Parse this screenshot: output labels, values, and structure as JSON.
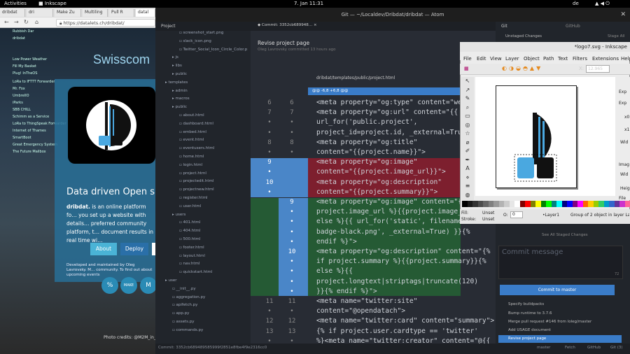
{
  "desktop": {
    "activities": "Activities",
    "app_name": "Inkscape",
    "clock": "7. Jan  11:31",
    "locale": "de"
  },
  "browser": {
    "tabs": [
      "dribdat",
      "dri",
      "Make Zu",
      "Multiling",
      "Pull R",
      "datal"
    ],
    "url": "https://datalets.ch/dribdat/",
    "swisscom": "Swisscom",
    "tagline": "Data driven Open s",
    "description_bold": "dribdat.",
    "description": " is an online platform fo… you set up a website with details… preferred community platform, t… document results in real time wi…",
    "buttons": [
      "About",
      "Deploy"
    ],
    "credit": "Developed and maintained by Oleg Lavrovsky. M… community. To find out about upcoming events",
    "round_buttons": [
      "%",
      "MAKE",
      "M"
    ],
    "photo_credit": "Photo credits: @M2M_in_Ac",
    "side_list": [
      "Rubbish Dar",
      "dribdat",
      "Low Power Weather",
      "Fill My Basket",
      "Plug! InTheOS",
      "LoRa to IFTTT Forwarder",
      "Mr. Fox",
      "UmbrelIO",
      "iParks",
      "SBB CHILL",
      "Schimm as a Service",
      "LoRa to ThingSpeak Forwarder",
      "Internet of Thames",
      "SmartBoot",
      "Great Emergency System",
      "The Future Mailbox"
    ]
  },
  "atom": {
    "window_title": "Git — ~/Localdev/Dribdat/dribdat — Atom",
    "project_tab": "Project",
    "editor_tab": "Commit: 3352cb689948…",
    "commit_title": "Revise project page",
    "commit_meta": "Oleg Lavrovsky committed 13 hours ago",
    "file_path": "dribdat/templates/public/project.html",
    "hunk_header": "@@ -6,8 +6,8 @@",
    "status_commit": "Commit: 3352cb689489585999f2851e8fbe4f9e2316cc0",
    "status_right": [
      "master",
      "Fetch",
      "GitHub",
      "Git (3)"
    ],
    "tree_items": [
      "screenshot_start.png",
      "slack_icon.png",
      "Twitter_Social_Icon_Circle_Color.p",
      "js",
      "libs",
      "public",
      "templates",
      "admin",
      "macros",
      "public",
      "about.html",
      "dashboard.html",
      "embed.html",
      "event.html",
      "eventusers.html",
      "home.html",
      "login.html",
      "project.html",
      "projectedit.html",
      "projectnew.html",
      "register.html",
      "user.html",
      "users",
      "401.html",
      "404.html",
      "500.html",
      "footer.html",
      "layout.html",
      "nav.html",
      "quickstart.html",
      "user",
      "__init__.py",
      "aggregation.py",
      "apifetch.py",
      "app.py",
      "assets.py",
      "commands.py"
    ],
    "code_lines": [
      {
        "old": "6",
        "new": "6",
        "text": "<meta property=\"og:type\" content=\"web",
        "type": "ctx"
      },
      {
        "old": "7",
        "new": "7",
        "text": "<meta property=\"og:url\" content=\"{{",
        "type": "ctx"
      },
      {
        "old": "•",
        "new": "•",
        "text": "url_for('public.project',",
        "type": "ctx"
      },
      {
        "old": "•",
        "new": "•",
        "text": "project_id=project.id, _external=True",
        "type": "ctx"
      },
      {
        "old": "8",
        "new": "8",
        "text": "<meta property=\"og:title\"",
        "type": "ctx"
      },
      {
        "old": "•",
        "new": "•",
        "text": "content=\"{{project.name}}\">",
        "type": "ctx"
      },
      {
        "old": "9",
        "new": "",
        "text": "<meta property=\"og:image\"",
        "type": "del"
      },
      {
        "old": "•",
        "new": "",
        "text": "content=\"{{project.image_url}}\">",
        "type": "del"
      },
      {
        "old": "10",
        "new": "",
        "text": "<meta property=\"og:description\"",
        "type": "del"
      },
      {
        "old": "•",
        "new": "",
        "text": "content=\"{{project.summary}}\">",
        "type": "del"
      },
      {
        "old": "",
        "new": "9",
        "text": "<meta property=\"og:image\" content=\"{%",
        "type": "add"
      },
      {
        "old": "",
        "new": "•",
        "text": "project.image_url %}{{project.image_ur",
        "type": "add"
      },
      {
        "old": "",
        "new": "•",
        "text": "else %}{{ url_for('static', filename=",
        "type": "add"
      },
      {
        "old": "",
        "new": "•",
        "text": "badge-black.png', _external=True) }}{%",
        "type": "add"
      },
      {
        "old": "",
        "new": "•",
        "text": "endif %}\">",
        "type": "add"
      },
      {
        "old": "",
        "new": "10",
        "text": "<meta property=\"og:description\" content=\"{%",
        "type": "add"
      },
      {
        "old": "",
        "new": "•",
        "text": "if project.summary %}{{project.summary}}{%",
        "type": "add"
      },
      {
        "old": "",
        "new": "•",
        "text": "else %}{{",
        "type": "add"
      },
      {
        "old": "",
        "new": "•",
        "text": "project.longtext|striptags|truncate(120)",
        "type": "add"
      },
      {
        "old": "",
        "new": "•",
        "text": "}}{% endif %}\">",
        "type": "add"
      },
      {
        "old": "11",
        "new": "11",
        "text": "<meta name=\"twitter:site\"",
        "type": "ctx"
      },
      {
        "old": "•",
        "new": "•",
        "text": "content=\"@opendatach\">",
        "type": "ctx"
      },
      {
        "old": "12",
        "new": "12",
        "text": "<meta name=\"twitter:card\" content=\"summary\">",
        "type": "ctx"
      },
      {
        "old": "13",
        "new": "13",
        "text": "{% if project.user.cardtype == 'twitter'",
        "type": "ctx"
      },
      {
        "old": "•",
        "new": "•",
        "text": "%}<meta name=\"twitter:creator\" content=\"@{{",
        "type": "ctx"
      }
    ],
    "git": {
      "tab_git": "Git",
      "tab_github": "GitHub",
      "unstaged": "Unstaged Changes",
      "stage_all": "Stage All",
      "staged_link": "See All Staged Changes",
      "commit_placeholder": "Commit message",
      "char_count": "72",
      "commit_button": "Commit to master",
      "log": [
        "Specify buildpacks",
        "Bump runtime to 3.7.6",
        "Merge pull request #146 from loleg/master",
        "Add USAGE document",
        "Revise project page"
      ]
    }
  },
  "inkscape": {
    "title": "*logo7.svg - Inkscape",
    "menu": [
      "File",
      "Edit",
      "View",
      "Layer",
      "Object",
      "Path",
      "Text",
      "Filters",
      "Extensions",
      "Help"
    ],
    "x_label": "X:",
    "x_value": "12.965",
    "side_labels": [
      "Exp",
      "Exp",
      "x0",
      "x1",
      "Wid",
      "Imag",
      "Wid",
      "Heig",
      "File"
    ],
    "fill_label": "Fill:",
    "fill_value": "Unset",
    "stroke_label": "Stroke:",
    "stroke_value": "Unset",
    "opacity": "0",
    "layer": "•Layer1",
    "status": "Group of 2 object in layer La"
  },
  "colors": {
    "accent_blue": "#3a7cc8",
    "diff_del": "#7d1f2e",
    "diff_add": "#255a34",
    "panel_blue": "#2a8bb5"
  }
}
